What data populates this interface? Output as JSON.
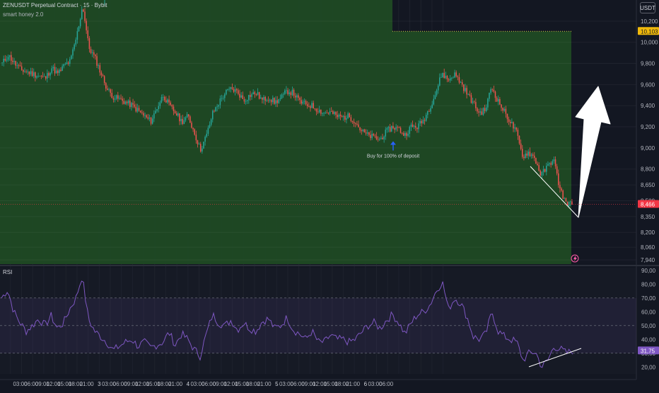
{
  "header": {
    "title": "ZENUSDT Perpetual Contract · 15 · Bybit",
    "indicator": "smart honey 2.0"
  },
  "currency_button": "USDT",
  "annotation": "Buy for 100% of deposit",
  "rsi_label": "RSI",
  "price_axis": {
    "ticks": [
      "10,200",
      "10,000",
      "9,800",
      "9,600",
      "9,400",
      "9,200",
      "9,000",
      "8,800",
      "8,650",
      "8,500",
      "8,350",
      "8,200",
      "8,060",
      "7,940"
    ],
    "badge_top": "10,103",
    "badge_last": "8,466"
  },
  "rsi_axis": {
    "ticks": [
      "90,00",
      "80,00",
      "70,00",
      "60,00",
      "50,00",
      "40,00",
      "30,00",
      "20,00"
    ],
    "badge": "31,75"
  },
  "time_axis": [
    "03:00",
    "06:00",
    "09:00",
    "12:00",
    "15:00",
    "18:00",
    "21:00",
    "3",
    "03:00",
    "06:00",
    "09:00",
    "12:00",
    "15:00",
    "18:00",
    "21:00",
    "4",
    "03:00",
    "06:00",
    "09:00",
    "12:00",
    "15:00",
    "18:00",
    "21:00",
    "5",
    "03:00",
    "06:00",
    "09:00",
    "12:00",
    "15:00",
    "18:00",
    "21:00",
    "6",
    "03:00",
    "06:00"
  ],
  "colors": {
    "background": "#131722",
    "profit_zone": "#1f4a24",
    "candle_up": "#26a69a",
    "candle_down": "#ef5350",
    "rsi_line": "#7e57c2",
    "badge_yellow": "#f0b90b",
    "badge_red": "#f23645",
    "badge_purple": "#7e57c2"
  },
  "chart_data": {
    "type": "candlestick",
    "price_path": [
      9800,
      9880,
      9800,
      9740,
      9720,
      9700,
      9680,
      9660,
      9760,
      9700,
      9780,
      9820,
      10050,
      10350,
      9950,
      9850,
      9700,
      9550,
      9480,
      9460,
      9430,
      9400,
      9350,
      9300,
      9250,
      9380,
      9500,
      9400,
      9330,
      9250,
      9300,
      9150,
      8980,
      9120,
      9330,
      9430,
      9520,
      9560,
      9530,
      9450,
      9500,
      9520,
      9450,
      9480,
      9430,
      9470,
      9540,
      9520,
      9440,
      9410,
      9400,
      9360,
      9330,
      9340,
      9300,
      9290,
      9300,
      9250,
      9160,
      9120,
      9100,
      9080,
      9150,
      9200,
      9180,
      9120,
      9200,
      9200,
      9260,
      9380,
      9520,
      9710,
      9640,
      9700,
      9620,
      9520,
      9430,
      9330,
      9360,
      9580,
      9450,
      9350,
      9250,
      9150,
      8920,
      8960,
      8900,
      8740,
      8820,
      8900,
      8620,
      8480,
      8466
    ],
    "price_range": [
      7900,
      10400
    ],
    "buy_signal_price": 9150,
    "target_price": 10103,
    "last_price": 8466,
    "rsi_path": [
      70,
      76,
      60,
      52,
      46,
      50,
      55,
      50,
      57,
      48,
      52,
      62,
      70,
      86,
      55,
      46,
      42,
      38,
      32,
      35,
      38,
      40,
      35,
      38,
      34,
      36,
      38,
      45,
      36,
      44,
      40,
      33,
      28,
      44,
      58,
      52,
      50,
      54,
      47,
      52,
      48,
      46,
      53,
      55,
      48,
      50,
      56,
      47,
      44,
      40,
      46,
      38,
      38,
      43,
      40,
      40,
      38,
      40,
      45,
      50,
      52,
      48,
      54,
      58,
      52,
      44,
      52,
      58,
      60,
      65,
      75,
      82,
      62,
      70,
      66,
      56,
      42,
      40,
      44,
      60,
      46,
      42,
      40,
      38,
      25,
      30,
      31,
      20,
      25,
      35,
      33,
      30,
      31.75
    ],
    "rsi_range": [
      15,
      92
    ],
    "rsi_levels": [
      70,
      50,
      30
    ]
  }
}
